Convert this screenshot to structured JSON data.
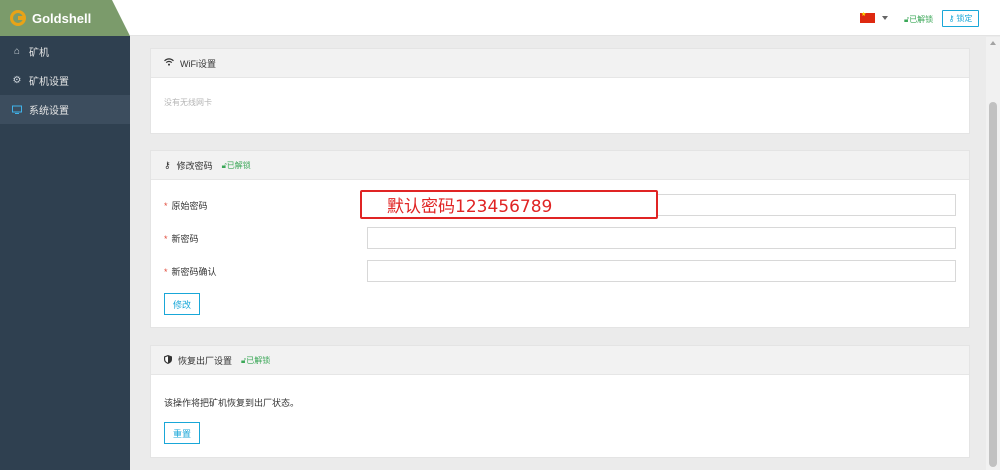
{
  "brand": {
    "name": "Goldshell",
    "accent": "#e8a317",
    "header_bg": "#7b9b6b"
  },
  "sidebar": {
    "bg": "#2f4050",
    "items": [
      {
        "label": "矿机",
        "icon": "home-icon"
      },
      {
        "label": "矿机设置",
        "icon": "gear-icon"
      },
      {
        "label": "系统设置",
        "icon": "monitor-icon",
        "active": true
      }
    ]
  },
  "topbar": {
    "language_flag": "cn-flag-icon",
    "unlocked_label": "已解锁",
    "lock_button": "锁定"
  },
  "wifi_panel": {
    "title": "WiFi设置",
    "icon": "wifi-icon",
    "empty_text": "没有无线网卡"
  },
  "password_panel": {
    "title": "修改密码",
    "icon": "key-icon",
    "badge": "已解锁",
    "fields": [
      {
        "label": "原始密码",
        "value": "",
        "placeholder": ""
      },
      {
        "label": "新密码",
        "value": "",
        "placeholder": ""
      },
      {
        "label": "新密码确认",
        "value": "",
        "placeholder": ""
      }
    ],
    "submit": "修改",
    "annotation": "默认密码123456789"
  },
  "reset_panel": {
    "title": "恢复出厂设置",
    "icon": "shield-icon",
    "badge": "已解锁",
    "description": "该操作将把矿机恢复到出厂状态。",
    "button": "重置"
  }
}
